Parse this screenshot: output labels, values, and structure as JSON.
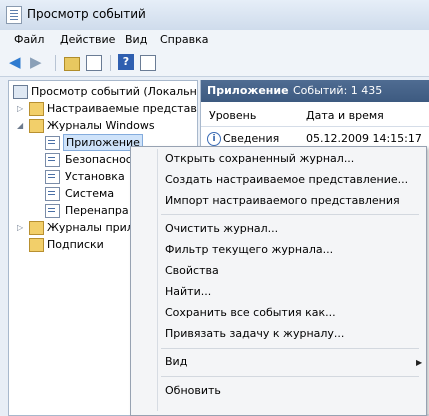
{
  "window": {
    "title": "Просмотр событий"
  },
  "menu": [
    "Файл",
    "Действие",
    "Вид",
    "Справка"
  ],
  "toolbar": {
    "back_icon": "back-arrow-icon",
    "forward_icon": "forward-arrow-icon",
    "help_label": "?"
  },
  "tree": {
    "root": "Просмотр событий (Локальнь",
    "custom_views": "Настраиваемые представле",
    "windows_logs": "Журналы Windows",
    "app": "Приложение",
    "security": "Безопаснос",
    "setup": "Установка",
    "system": "Система",
    "forwarded": "Перенапра",
    "app_logs": "Журналы прил",
    "subscriptions": "Подписки"
  },
  "panel": {
    "title": "Приложение",
    "count": "Событий: 1 435",
    "columns": {
      "level": "Уровень",
      "date": "Дата и время"
    },
    "rows": [
      {
        "level": "Сведения",
        "date": "05.12.2009 14:15:17"
      }
    ]
  },
  "context_menu": {
    "items": [
      "Открыть сохраненный журнал...",
      "Создать настраиваемое представление...",
      "Импорт настраиваемого представления",
      "Очистить журнал...",
      "Фильтр текущего журнала...",
      "Свойства",
      "Найти...",
      "Сохранить все события как...",
      "Привязать задачу к журналу...",
      "Вид",
      "Обновить"
    ],
    "submenu_arrow": "▶"
  }
}
